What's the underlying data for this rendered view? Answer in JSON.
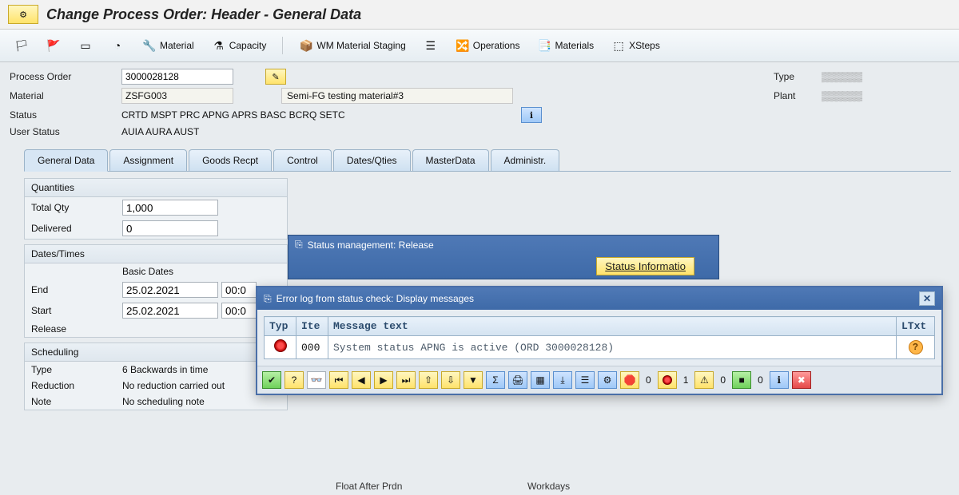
{
  "title": "Change Process Order: Header - General Data",
  "toolbar": {
    "material": "Material",
    "capacity": "Capacity",
    "wm_staging": "WM Material Staging",
    "operations": "Operations",
    "materials": "Materials",
    "xsteps": "XSteps"
  },
  "header": {
    "process_order_label": "Process Order",
    "process_order": "3000028128",
    "material_label": "Material",
    "material": "ZSFG003",
    "material_desc": "Semi-FG testing material#3",
    "status_label": "Status",
    "status": "CRTD MSPT PRC  APNG APRS BASC BCRQ SETC",
    "user_status_label": "User Status",
    "user_status": "AUIA AURA AUST",
    "type_label": "Type",
    "plant_label": "Plant"
  },
  "tabs": [
    "General Data",
    "Assignment",
    "Goods Recpt",
    "Control",
    "Dates/Qties",
    "MasterData",
    "Administr."
  ],
  "quantities": {
    "title": "Quantities",
    "total_qty_label": "Total Qty",
    "total_qty": "1,000",
    "delivered_label": "Delivered",
    "delivered": "0"
  },
  "dates": {
    "title": "Dates/Times",
    "basic_dates": "Basic Dates",
    "end_label": "End",
    "end_date": "25.02.2021",
    "end_time": "00:0",
    "start_label": "Start",
    "start_date": "25.02.2021",
    "start_time": "00:0",
    "release_label": "Release"
  },
  "scheduling": {
    "title": "Scheduling",
    "type_label": "Type",
    "type": "6 Backwards in time",
    "reduction_label": "Reduction",
    "reduction": "No reduction carried out",
    "note_label": "Note",
    "note": "No scheduling note"
  },
  "status_mgmt": {
    "title": "Status management: Release",
    "status_info": "Status Informatio"
  },
  "dialog": {
    "title": "Error log from status check: Display messages",
    "col_typ": "Typ",
    "col_item": "Ite",
    "col_msg": "Message text",
    "col_ltxt": "LTxt",
    "row_item": "000",
    "row_msg": "System status APNG is active (ORD 3000028128)",
    "counts": {
      "stop": "0",
      "err": "1",
      "warn": "0",
      "ok": "0"
    }
  },
  "footer": {
    "float_after": "Float After Prdn",
    "workdays": "Workdays"
  }
}
